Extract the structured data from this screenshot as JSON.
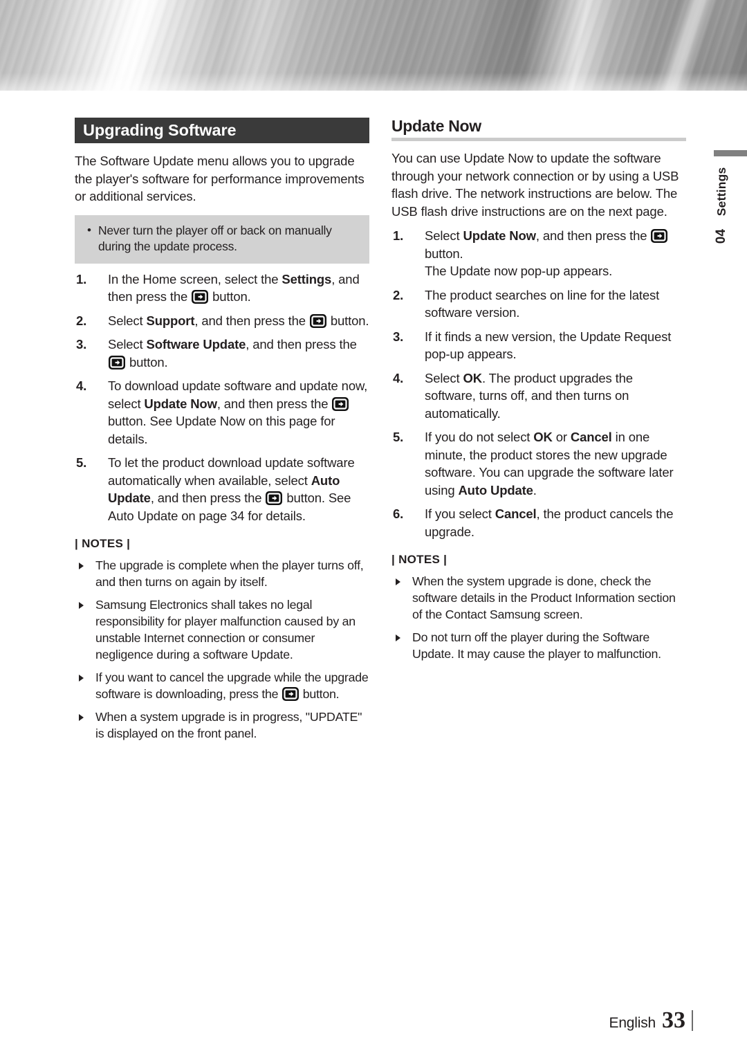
{
  "banner": {
    "name": "metallic-banner"
  },
  "side_tab": {
    "chapter_number": "04",
    "chapter_name": "Settings"
  },
  "footer": {
    "language": "English",
    "page_number": "33"
  },
  "left_column": {
    "section_title": "Upgrading Software",
    "intro": "The Software Update menu allows you to upgrade the player's software for performance improvements or additional services.",
    "caution": [
      "Never turn the player off or back on manually during the update process."
    ],
    "steps": [
      {
        "num": "1.",
        "parts": [
          {
            "t": "In the Home screen, select the ",
            "b": false
          },
          {
            "t": "Settings",
            "b": true
          },
          {
            "t": ", and then press the ",
            "b": false
          },
          {
            "t": "ICON",
            "b": false
          },
          {
            "t": " button.",
            "b": false
          }
        ]
      },
      {
        "num": "2.",
        "parts": [
          {
            "t": "Select ",
            "b": false
          },
          {
            "t": "Support",
            "b": true
          },
          {
            "t": ", and then press the ",
            "b": false
          },
          {
            "t": "ICON",
            "b": false
          },
          {
            "t": " button.",
            "b": false
          }
        ]
      },
      {
        "num": "3.",
        "parts": [
          {
            "t": "Select ",
            "b": false
          },
          {
            "t": "Software Update",
            "b": true
          },
          {
            "t": ", and then press the ",
            "b": false
          },
          {
            "t": "ICON",
            "b": false
          },
          {
            "t": " button.",
            "b": false
          }
        ]
      },
      {
        "num": "4.",
        "parts": [
          {
            "t": "To download update software and update now, select ",
            "b": false
          },
          {
            "t": "Update Now",
            "b": true
          },
          {
            "t": ", and then press the ",
            "b": false
          },
          {
            "t": "ICON",
            "b": false
          },
          {
            "t": " button. See Update Now on this page for details.",
            "b": false
          }
        ]
      },
      {
        "num": "5.",
        "parts": [
          {
            "t": "To let the product download update software automatically when available, select ",
            "b": false
          },
          {
            "t": "Auto Update",
            "b": true
          },
          {
            "t": ", and then press the ",
            "b": false
          },
          {
            "t": "ICON",
            "b": false
          },
          {
            "t": " button. See Auto Update on page 34 for details.",
            "b": false
          }
        ]
      }
    ],
    "notes_title": "| NOTES |",
    "notes": [
      {
        "parts": [
          {
            "t": "The upgrade is complete when the player turns off, and then turns on again by itself.",
            "b": false
          }
        ]
      },
      {
        "parts": [
          {
            "t": "Samsung Electronics shall takes no legal responsibility for player malfunction caused by an unstable Internet connection or consumer negligence during a software Update.",
            "b": false
          }
        ]
      },
      {
        "parts": [
          {
            "t": "If you want to cancel the upgrade while the upgrade software is downloading, press the ",
            "b": false
          },
          {
            "t": "ICON",
            "b": false
          },
          {
            "t": " button.",
            "b": false
          }
        ]
      },
      {
        "parts": [
          {
            "t": "When a system upgrade is in progress, \"UPDATE\" is displayed on the front panel.",
            "b": false
          }
        ]
      }
    ]
  },
  "right_column": {
    "section_title": "Update Now",
    "intro": "You can use Update Now to update the software through your network connection or by using a USB flash drive. The network instructions are below. The USB flash drive instructions are on the next page.",
    "steps": [
      {
        "num": "1.",
        "parts": [
          {
            "t": "Select ",
            "b": false
          },
          {
            "t": "Update Now",
            "b": true
          },
          {
            "t": ", and then press the ",
            "b": false
          },
          {
            "t": "ICON",
            "b": false
          },
          {
            "t": " button.",
            "b": false
          }
        ],
        "subline": "The Update now pop-up appears."
      },
      {
        "num": "2.",
        "parts": [
          {
            "t": "The product searches on line for the latest software version.",
            "b": false
          }
        ]
      },
      {
        "num": "3.",
        "parts": [
          {
            "t": "If it finds a new version, the Update Request pop-up appears.",
            "b": false
          }
        ]
      },
      {
        "num": "4.",
        "parts": [
          {
            "t": "Select ",
            "b": false
          },
          {
            "t": "OK",
            "b": true
          },
          {
            "t": ". The product upgrades the software, turns off, and then turns on automatically.",
            "b": false
          }
        ]
      },
      {
        "num": "5.",
        "parts": [
          {
            "t": "If you do not select ",
            "b": false
          },
          {
            "t": "OK",
            "b": true
          },
          {
            "t": " or ",
            "b": false
          },
          {
            "t": "Cancel",
            "b": true
          },
          {
            "t": " in one minute, the product stores the new upgrade software. You can upgrade the software later using ",
            "b": false
          },
          {
            "t": "Auto Update",
            "b": true
          },
          {
            "t": ".",
            "b": false
          }
        ]
      },
      {
        "num": "6.",
        "parts": [
          {
            "t": "If you select ",
            "b": false
          },
          {
            "t": "Cancel",
            "b": true
          },
          {
            "t": ", the product cancels the upgrade.",
            "b": false
          }
        ]
      }
    ],
    "notes_title": "| NOTES |",
    "notes": [
      {
        "parts": [
          {
            "t": "When the system upgrade is done, check the software details in the Product Information section of the Contact Samsung screen.",
            "b": false
          }
        ]
      },
      {
        "parts": [
          {
            "t": "Do not turn off the player during the Software Update. It may cause the player to malfunction.",
            "b": false
          }
        ]
      }
    ]
  },
  "icons": {
    "enter_button": "enter-button-icon"
  },
  "colors": {
    "section_bar": "#3a3a3a",
    "caution_box": "#d2d2d2",
    "rule": "#cbcbcb",
    "text": "#231f20"
  }
}
